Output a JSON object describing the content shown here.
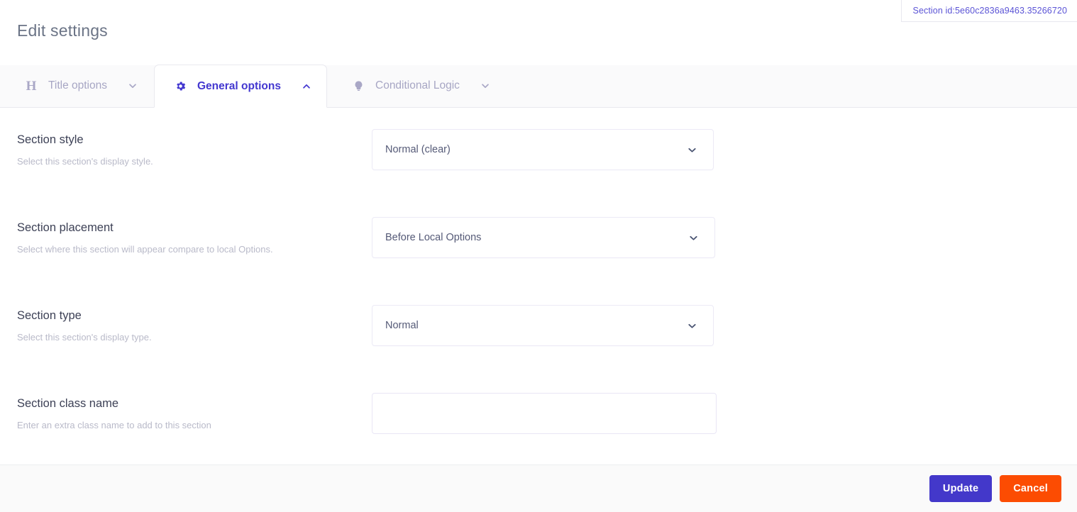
{
  "badge": {
    "text": "Section id:5e60c2836a9463.35266720",
    "color": "#5b54d6"
  },
  "header": {
    "title": "Edit settings"
  },
  "tabs": [
    {
      "id": "title-options",
      "label": "Title options",
      "icon": "heading-h-icon",
      "caret": "chevron-down-icon",
      "active": false
    },
    {
      "id": "general-options",
      "label": "General options",
      "icon": "gear-icon",
      "caret": "chevron-up-icon",
      "active": true
    },
    {
      "id": "conditional-logic",
      "label": "Conditional Logic",
      "icon": "lightbulb-icon",
      "caret": "chevron-down-icon",
      "active": false
    }
  ],
  "fields": [
    {
      "id": "section-style",
      "label": "Section style",
      "description": "Select this section's display style.",
      "control": "select",
      "value": "Normal (clear)"
    },
    {
      "id": "section-placement",
      "label": "Section placement",
      "description": "Select where this section will appear compare to local Options.",
      "control": "select",
      "value": "Before Local Options"
    },
    {
      "id": "section-type",
      "label": "Section type",
      "description": "Select this section's display type.",
      "control": "select",
      "value": "Normal"
    },
    {
      "id": "section-class-name",
      "label": "Section class name",
      "description": "Enter an extra class name to add to this section",
      "control": "text",
      "value": "",
      "placeholder": ""
    }
  ],
  "footer": {
    "update_label": "Update",
    "cancel_label": "Cancel",
    "update_color": "#4338ca",
    "cancel_color": "#fc4c02"
  }
}
